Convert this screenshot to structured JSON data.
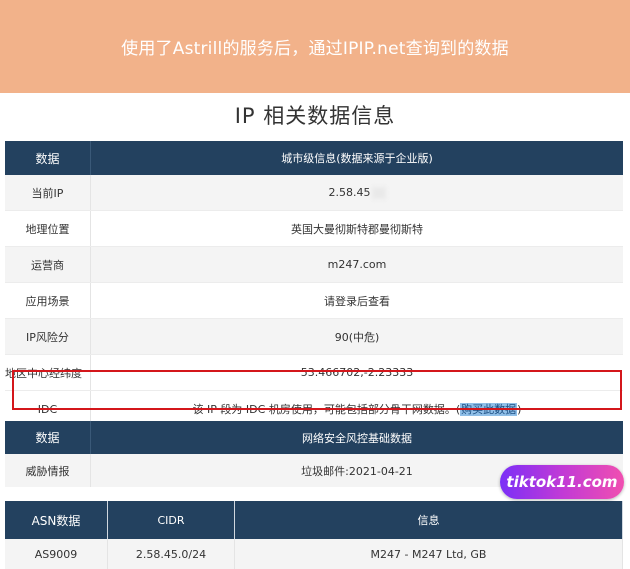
{
  "banner": {
    "text": "使用了Astrill的服务后，通过IPIP.net查询到的数据"
  },
  "page_title": "IP 相关数据信息",
  "city_table": {
    "header_label": "数据",
    "header_value": "城市级信息(数据来源于企业版)",
    "rows": [
      {
        "label": "当前IP",
        "value": "2.58.45"
      },
      {
        "label": "地理位置",
        "value": "英国大曼彻斯特郡曼彻斯特"
      },
      {
        "label": "运营商",
        "value": "m247.com"
      },
      {
        "label": "应用场景",
        "value": "请登录后查看"
      },
      {
        "label": "IP风险分",
        "value": "90(中危)"
      },
      {
        "label": "地区中心经纬度",
        "value": "53.466702,-2.23333"
      }
    ],
    "idc": {
      "label": "IDC",
      "value_text": "该 IP 段为 IDC 机房使用，可能包括部分骨干网数据。(",
      "link_text": "购买此数据",
      "value_suffix": ")"
    }
  },
  "security_table": {
    "header_label": "数据",
    "header_value": "网络安全风控基础数据",
    "rows": [
      {
        "label": "威胁情报",
        "value": "垃圾邮件:2021-04-21"
      }
    ]
  },
  "asn_table": {
    "headers": [
      "ASN数据",
      "CIDR",
      "信息"
    ],
    "rows": [
      {
        "asn": "AS9009",
        "cidr": "2.58.45.0/24",
        "info": "M247 - M247 Ltd, GB"
      }
    ]
  },
  "watermark": {
    "text": "tiktok11.com"
  },
  "colors": {
    "banner_bg": "#f2b28a",
    "header_bg": "#23415f",
    "highlight_box": "#d4161b",
    "link_highlight": "#8fbfe8"
  }
}
